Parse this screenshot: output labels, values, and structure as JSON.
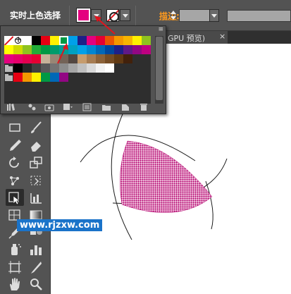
{
  "control_bar": {
    "title": "实时上色选择",
    "fill_color": "#e4007f",
    "stroke_label": "描边:",
    "stroke_label_color": "#ff9a1e"
  },
  "document_tab": {
    "label": "GPU 预览)",
    "close_glyph": "×"
  },
  "swatches_panel": {
    "rows": [
      [
        "none",
        "registration",
        "#ffffff",
        "#000000",
        "#e60012",
        "#fff100",
        "#009944",
        "#00a0e9",
        "#1d2088",
        "#e4007f",
        "#e60033",
        "#ea5504",
        "#f39800",
        "#f8b500",
        "#fff100",
        "#8fc31f"
      ],
      [
        "#ffff00",
        "#cfdb00",
        "#8fc31f",
        "#22ac38",
        "#009944",
        "#009b6b",
        "#009e96",
        "#00a0c1",
        "#00a0e9",
        "#0086d1",
        "#0068b7",
        "#00479d",
        "#1d2088",
        "#601986",
        "#920783",
        "#be0081"
      ],
      [
        "#e4007f",
        "#e5006a",
        "#e5004f",
        "#e60033",
        "#c7b299",
        "#998675",
        "#736357",
        "#534741",
        "#c69c6d",
        "#a67c52",
        "#8c6239",
        "#754c24",
        "#603913",
        "#42210b"
      ],
      [
        "folder",
        "#000000",
        "#262626",
        "#404040",
        "#595959",
        "#737373",
        "#8c8c8c",
        "#a6a6a6",
        "#bfbfbf",
        "#d9d9d9",
        "#f2f2f2",
        "#ffffff"
      ],
      [
        "folder",
        "#e60012",
        "#f39800",
        "#fff100",
        "#009944",
        "#0068b7",
        "#920783"
      ]
    ],
    "selected_row": 0,
    "selected_col": 6,
    "menu_glyph": "≡"
  },
  "tools": [
    "rectangle-tool",
    "paintbrush-tool",
    "pencil-tool",
    "eraser-tool",
    "rotate-tool",
    "scale-tool",
    "puppet-warp-tool",
    "free-transform-tool",
    "live-paint-selection-tool",
    "shape-builder-tool",
    "perspective-grid-tool",
    "gradient-tool",
    "eyedropper-tool",
    "blend-tool",
    "symbol-sprayer-tool",
    "column-graph-tool",
    "artboard-tool",
    "slice-tool",
    "hand-tool",
    "zoom-tool"
  ],
  "artwork": {
    "fill_color": "#c0187a",
    "pattern": "dots"
  },
  "watermark": "www.rjzxw.com",
  "annotation_color": "#e0141e"
}
